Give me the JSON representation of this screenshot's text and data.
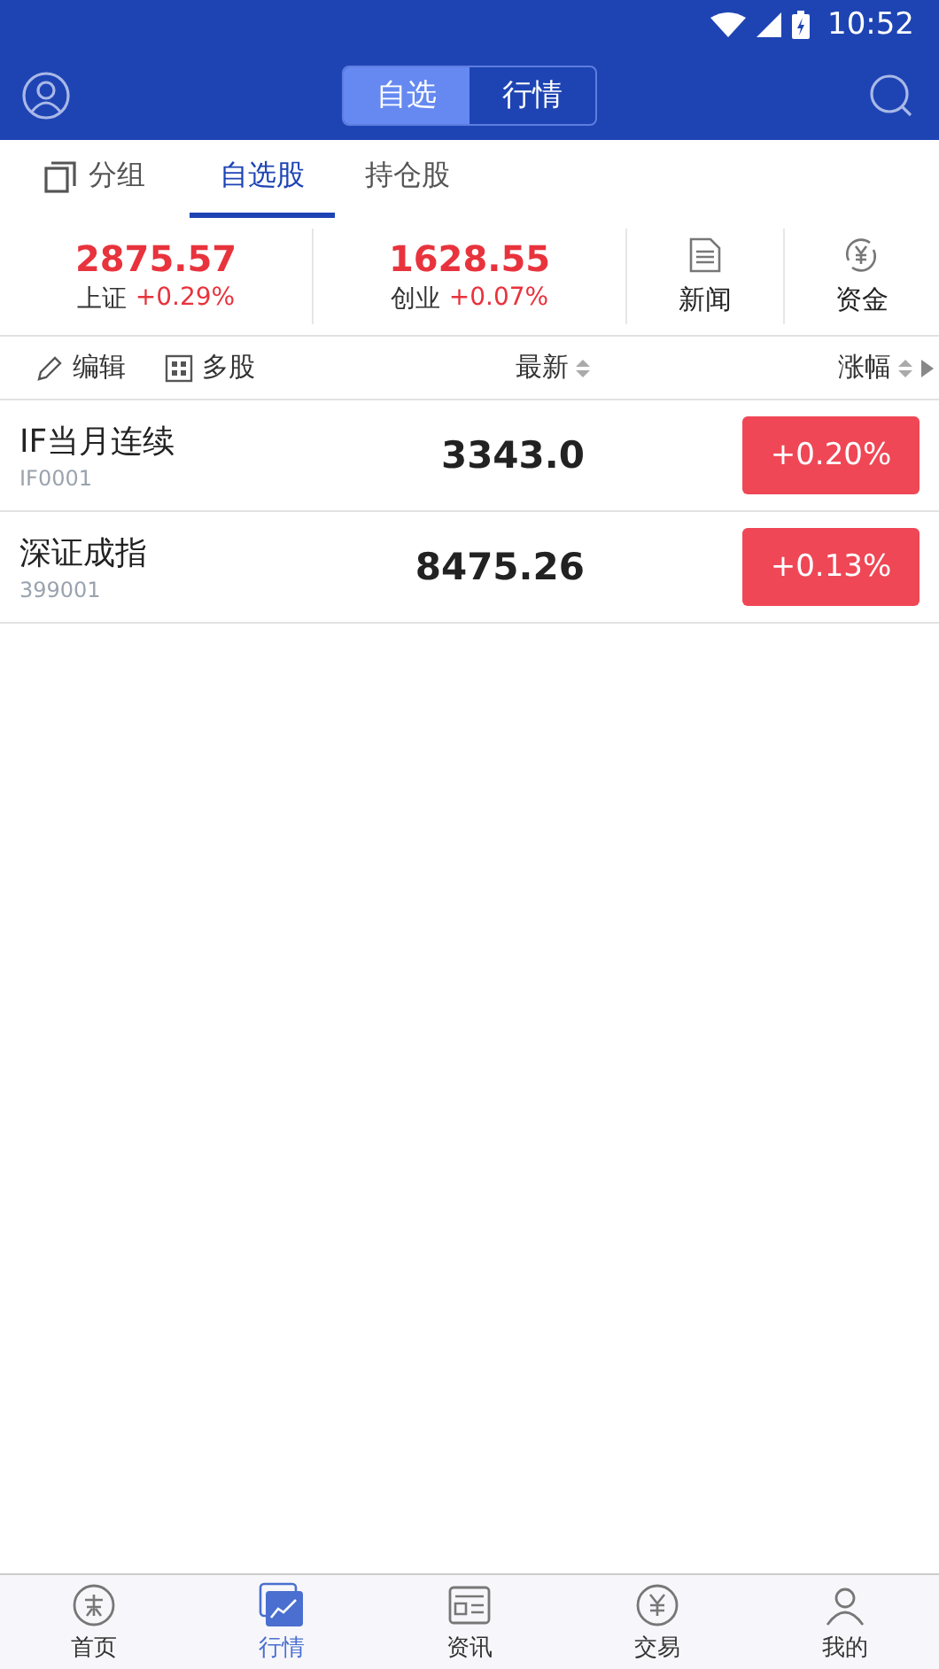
{
  "status_bar": {
    "time": "10:52"
  },
  "header": {
    "segments": [
      {
        "label": "自选",
        "selected": true
      },
      {
        "label": "行情",
        "selected": false
      }
    ]
  },
  "tabs": [
    {
      "label": "分组",
      "kind": "group",
      "selected": false
    },
    {
      "label": "自选股",
      "kind": "tab",
      "selected": true
    },
    {
      "label": "持仓股",
      "kind": "tab",
      "selected": false
    }
  ],
  "indices": [
    {
      "value": "2875.57",
      "name": "上证",
      "change": "+0.29%"
    },
    {
      "value": "1628.55",
      "name": "创业",
      "change": "+0.07%"
    }
  ],
  "shortcuts": [
    {
      "label": "新闻",
      "kind": "news"
    },
    {
      "label": "资金",
      "kind": "fund"
    }
  ],
  "toolbar": {
    "edit": "编辑",
    "multi": "多股",
    "latest": "最新",
    "change": "涨幅"
  },
  "rows": [
    {
      "name": "IF当月连续",
      "code": "IF0001",
      "price": "3343.0",
      "change": "+0.20%"
    },
    {
      "name": "深证成指",
      "code": "399001",
      "price": "8475.26",
      "change": "+0.13%"
    }
  ],
  "bottom_nav": [
    {
      "label": "首页",
      "kind": "home",
      "selected": false
    },
    {
      "label": "行情",
      "kind": "market",
      "selected": true
    },
    {
      "label": "资讯",
      "kind": "news",
      "selected": false
    },
    {
      "label": "交易",
      "kind": "trade",
      "selected": false
    },
    {
      "label": "我的",
      "kind": "me",
      "selected": false
    }
  ]
}
